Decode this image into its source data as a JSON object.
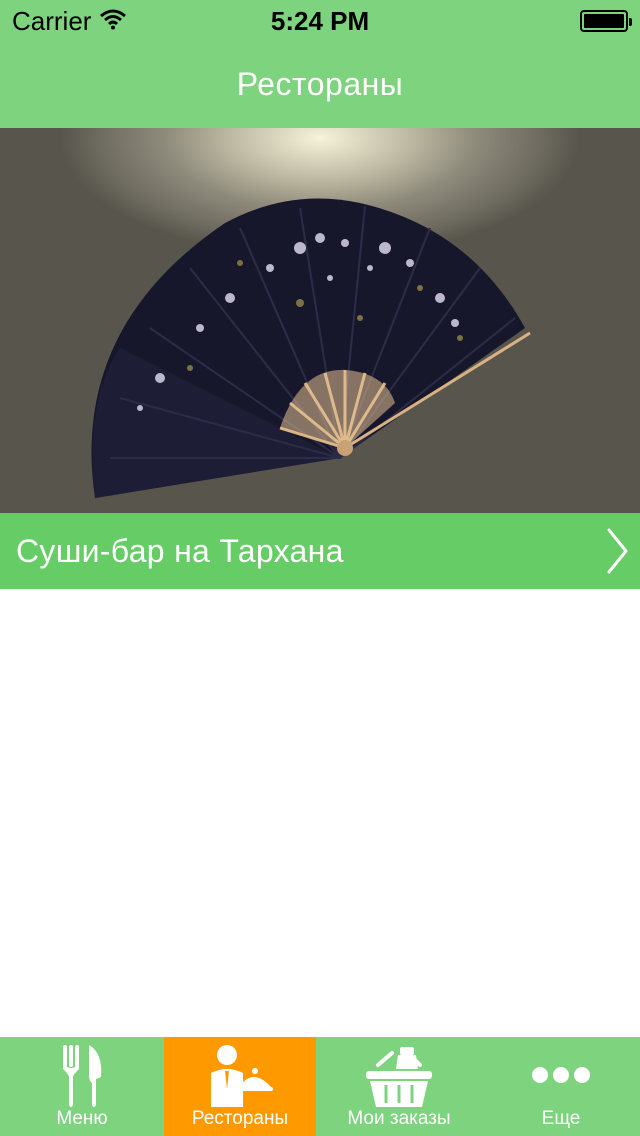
{
  "status_bar": {
    "carrier": "Carrier",
    "time": "5:24 PM"
  },
  "nav": {
    "title": "Рестораны"
  },
  "restaurant": {
    "name": "Суши-бар на Тархана"
  },
  "tabs": [
    {
      "label": "Меню",
      "icon": "fork-knife-icon",
      "active": false
    },
    {
      "label": "Рестораны",
      "icon": "waiter-icon",
      "active": true
    },
    {
      "label": "Мои заказы",
      "icon": "basket-icon",
      "active": false
    },
    {
      "label": "Еще",
      "icon": "more-icon",
      "active": false
    }
  ],
  "colors": {
    "header_green": "#7ed37e",
    "row_green": "#66cc66",
    "active_tab": "#ff9900",
    "text": "#ffffff"
  }
}
